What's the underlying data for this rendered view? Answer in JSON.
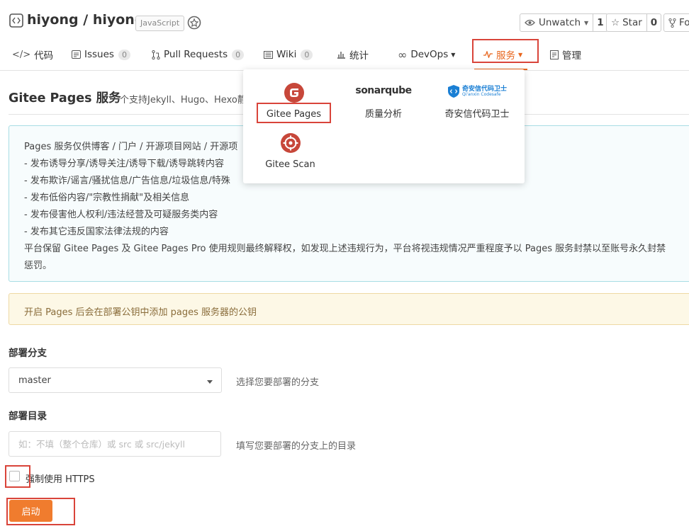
{
  "header": {
    "owner": "hiyong",
    "separator": "/",
    "repo": "hiyong",
    "language": "JavaScript",
    "watch": {
      "label": "Unwatch",
      "count": "1"
    },
    "star": {
      "label": "Star",
      "count": "0"
    },
    "fork": {
      "label": "Fo"
    }
  },
  "tabs": [
    {
      "label": "代码",
      "icon": "code-icon"
    },
    {
      "label": "Issues",
      "badge": "0",
      "icon": "issues-icon"
    },
    {
      "label": "Pull Requests",
      "badge": "0",
      "icon": "pull-request-icon"
    },
    {
      "label": "Wiki",
      "badge": "0",
      "icon": "wiki-icon"
    },
    {
      "label": "统计",
      "icon": "stats-icon"
    },
    {
      "label": "DevOps",
      "icon": "devops-icon"
    },
    {
      "label": "服务",
      "icon": "pulse-icon",
      "active": true
    },
    {
      "label": "管理",
      "icon": "manage-icon"
    }
  ],
  "dropdown": {
    "items": [
      {
        "label": "Gitee Pages",
        "icon": "gitee-pages-icon"
      },
      {
        "label": "质量分析",
        "logo_text": "sonarqube",
        "icon": "sonarqube-logo"
      },
      {
        "label": "奇安信代码卫士",
        "logo_text": "奇安信代码卫士",
        "logo_subtext": "Qi'anxin Codesafe",
        "icon": "codesafe-logo"
      },
      {
        "label": "Gitee Scan",
        "icon": "gitee-scan-icon"
      }
    ]
  },
  "page": {
    "title": "Gitee Pages 服务",
    "subtitle": "一个支持Jekyll、Hugo、Hexo静"
  },
  "notice": {
    "lines": [
      "Pages 服务仅供博客 / 门户 / 开源项目网站 / 开源项",
      "- 发布诱导分享/诱导关注/诱导下载/诱导跳转内容",
      "- 发布欺诈/谣言/骚扰信息/广告信息/垃圾信息/特殊",
      "- 发布低俗内容/\"宗教性捐献\"及相关信息",
      "- 发布侵害他人权利/违法经营及可疑服务类内容",
      "- 发布其它违反国家法律法规的内容",
      "平台保留 Gitee Pages 及 Gitee Pages Pro 使用规则最终解释权，如发现上述违规行为，平台将视违规情况严重程度予以 Pages 服务封禁以至账号永久封禁",
      "惩罚。"
    ]
  },
  "warning": {
    "text": "开启 Pages 后会在部署公钥中添加 pages 服务器的公钥"
  },
  "form": {
    "branch": {
      "label": "部署分支",
      "value": "master",
      "help": "选择您要部署的分支"
    },
    "directory": {
      "label": "部署目录",
      "placeholder": "如：不填（整个仓库）或 src 或 src/jekyll",
      "help": "填写您要部署的分支上的目录"
    },
    "https": {
      "label": "强制使用 HTTPS",
      "checked": false
    },
    "submit": {
      "label": "启动"
    }
  },
  "colors": {
    "accent": "#e8661e",
    "button": "#f07c2e",
    "highlight": "#d9443a",
    "gitee_red": "#c7473a"
  }
}
